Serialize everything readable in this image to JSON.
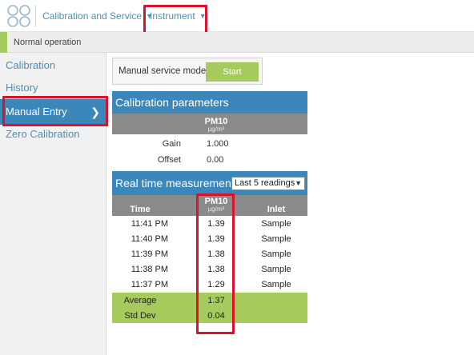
{
  "topbar": {
    "nav_calibration": "Calibration and Service",
    "nav_instrument": "Instrument"
  },
  "status": {
    "text": "Normal operation",
    "accent_color": "#a6cb5c"
  },
  "sidebar": {
    "items": [
      {
        "label": "Calibration"
      },
      {
        "label": "History"
      },
      {
        "label": "Manual Entry",
        "active": true
      },
      {
        "label": "Zero Calibration"
      }
    ]
  },
  "service": {
    "label": "Manual service mode",
    "start_label": "Start"
  },
  "calibration": {
    "title": "Calibration parameters",
    "column": "PM10",
    "unit": "µg/m³",
    "gain_label": "Gain",
    "gain_value": "1.000",
    "offset_label": "Offset",
    "offset_value": "0.00"
  },
  "realtime": {
    "title": "Real time measurements",
    "selected_option": "Last 5 readings",
    "col_time": "Time",
    "col_pm": "PM10",
    "col_unit": "µg/m³",
    "col_inlet": "Inlet",
    "rows": [
      {
        "time": "11:41 PM",
        "pm": "1.39",
        "inlet": "Sample"
      },
      {
        "time": "11:40 PM",
        "pm": "1.39",
        "inlet": "Sample"
      },
      {
        "time": "11:39 PM",
        "pm": "1.38",
        "inlet": "Sample"
      },
      {
        "time": "11:38 PM",
        "pm": "1.38",
        "inlet": "Sample"
      },
      {
        "time": "11:37 PM",
        "pm": "1.29",
        "inlet": "Sample"
      }
    ],
    "average_label": "Average",
    "average_value": "1.37",
    "stddev_label": "Std Dev",
    "stddev_value": "0.04"
  },
  "colors": {
    "brand_blue": "#3b87b9",
    "accent_green": "#a6cb5c",
    "highlight_red": "#d7142b"
  }
}
